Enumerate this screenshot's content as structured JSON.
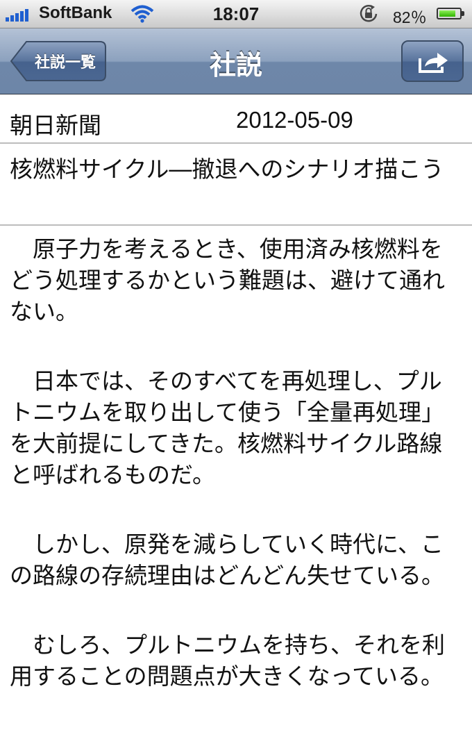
{
  "status_bar": {
    "carrier": "SoftBank",
    "time": "18:07",
    "battery_percent": "82％",
    "battery_level": 0.82,
    "icons": [
      "signal-bars-icon",
      "wifi-icon",
      "rotation-lock-icon",
      "battery-icon"
    ]
  },
  "nav": {
    "back_label": "社説一覧",
    "title": "社説",
    "share_icon": "share-arrow-icon"
  },
  "article": {
    "source": "朝日新聞",
    "date": "2012-05-09",
    "headline": "核燃料サイクル―撤退へのシナリオ描こう",
    "paragraphs": [
      "　原子力を考えるとき、使用済み核燃料をどう処理するかという難題は、避けて通れない。",
      "　日本では、そのすべてを再処理し、プルトニウムを取り出して使う「全量再処理」を大前提にしてきた。核燃料サイクル路線と呼ばれるものだ。",
      "　しかし、原発を減らしていく時代に、この路線の存続理由はどんどん失せている。",
      "　むしろ、プルトニウムを持ち、それを利用することの問題点が大きくなっている。"
    ]
  },
  "colors": {
    "nav_bar": "#8ca1be",
    "status_bar": "#d8d8d8",
    "battery_green": "#2fb300",
    "signal_blue": "#1f5fd0"
  }
}
